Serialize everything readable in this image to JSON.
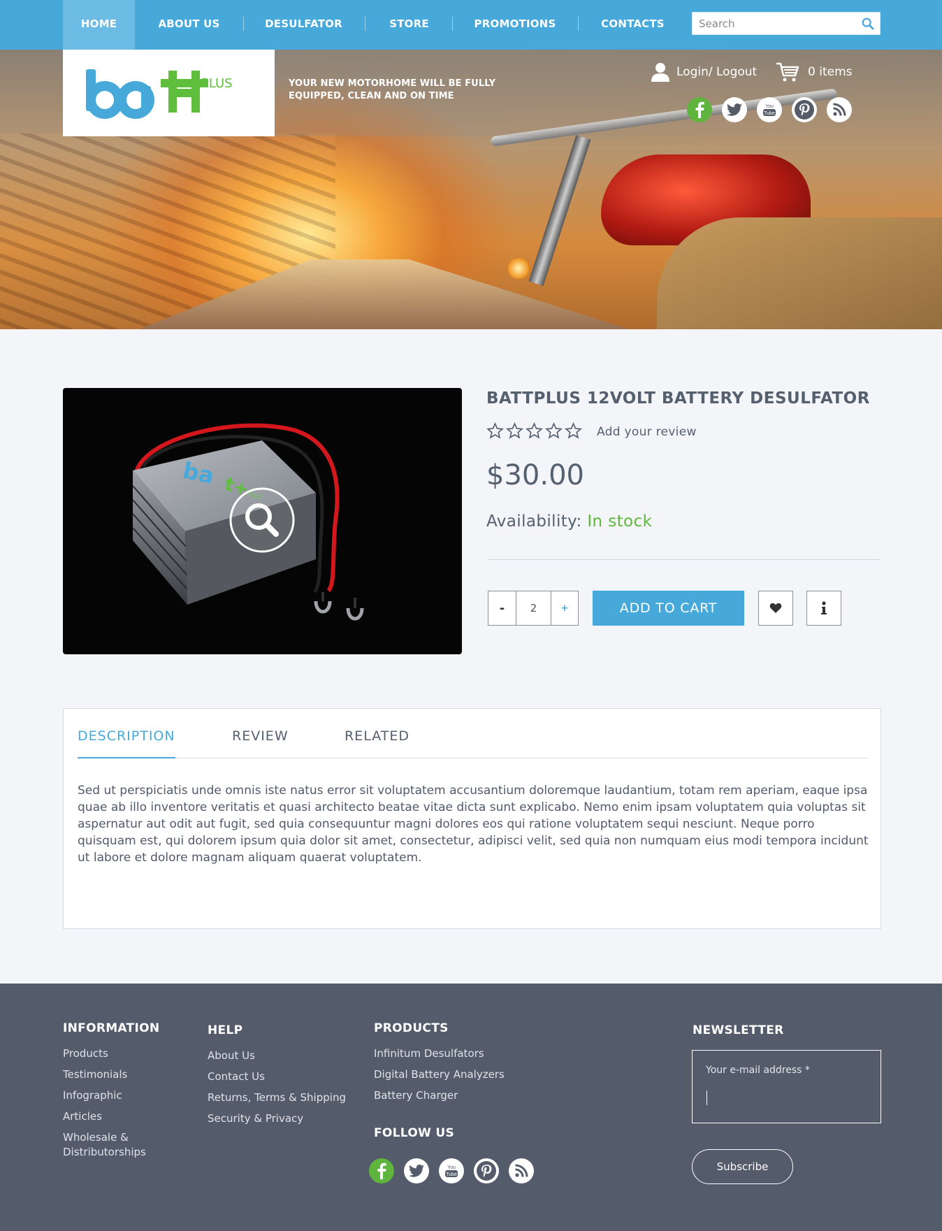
{
  "nav": {
    "items": [
      "HOME",
      "ABOUT US",
      "DESULFATOR",
      "STORE",
      "PROMOTIONS",
      "CONTACTS"
    ],
    "search_placeholder": "Search"
  },
  "header": {
    "tagline": "YOUR NEW MOTORHOME WILL BE FULLY EQUIPPED, CLEAN AND ON TIME",
    "logo_text": "PLUS",
    "login_label": "Login/ Logout",
    "cart_label": "0 items",
    "social_icons": [
      "facebook-icon",
      "twitter-icon",
      "youtube-icon",
      "pinterest-icon",
      "rss-icon"
    ]
  },
  "product": {
    "title": "BATTPLUS 12VOLT BATTERY DESULFATOR",
    "rating": 0,
    "rating_max": 5,
    "review_link": "Add your review",
    "price": "$30.00",
    "availability_label": "Availability:",
    "availability_value": "In stock",
    "quantity": "2",
    "minus_label": "-",
    "plus_label": "+",
    "add_to_cart": "ADD TO CART",
    "image_logo_text": "PLUS"
  },
  "tabs": {
    "items": [
      "DESCRIPTION",
      "REVIEW",
      "RELATED"
    ],
    "active": "DESCRIPTION",
    "description": "Sed ut perspiciatis unde omnis iste natus error sit voluptatem accusantium doloremque laudantium, totam rem aperiam, eaque ipsa quae ab illo inventore veritatis et quasi architecto beatae vitae dicta sunt explicabo. Nemo enim ipsam voluptatem quia voluptas sit aspernatur aut odit aut fugit, sed quia consequuntur magni dolores eos qui ratione voluptatem sequi nesciunt. Neque porro quisquam est, qui dolorem ipsum quia dolor sit amet, consectetur, adipisci velit, sed quia non numquam eius modi tempora incidunt ut labore et dolore magnam aliquam quaerat voluptatem."
  },
  "footer": {
    "information": {
      "heading": "INFORMATION",
      "links": [
        "Products",
        "Testimonials",
        "Infographic",
        "Articles",
        "Wholesale &",
        "Distributorships"
      ]
    },
    "help": {
      "heading": "HELP",
      "links": [
        "About Us",
        "Contact Us",
        "Returns, Terms & Shipping",
        "Security & Privacy"
      ]
    },
    "products": {
      "heading": "PRODUCTS",
      "links": [
        "Infinitum Desulfators",
        "Digital Battery Analyzers",
        "Battery Charger"
      ]
    },
    "follow": {
      "heading": "FOLLOW US"
    },
    "newsletter": {
      "heading": "NEWSLETTER",
      "placeholder": "Your e-mail address *",
      "button": "Subscribe"
    }
  },
  "colors": {
    "accent": "#47a9da",
    "green": "#5cb83c",
    "footer_bg": "#545c6b",
    "text": "#55606f"
  }
}
